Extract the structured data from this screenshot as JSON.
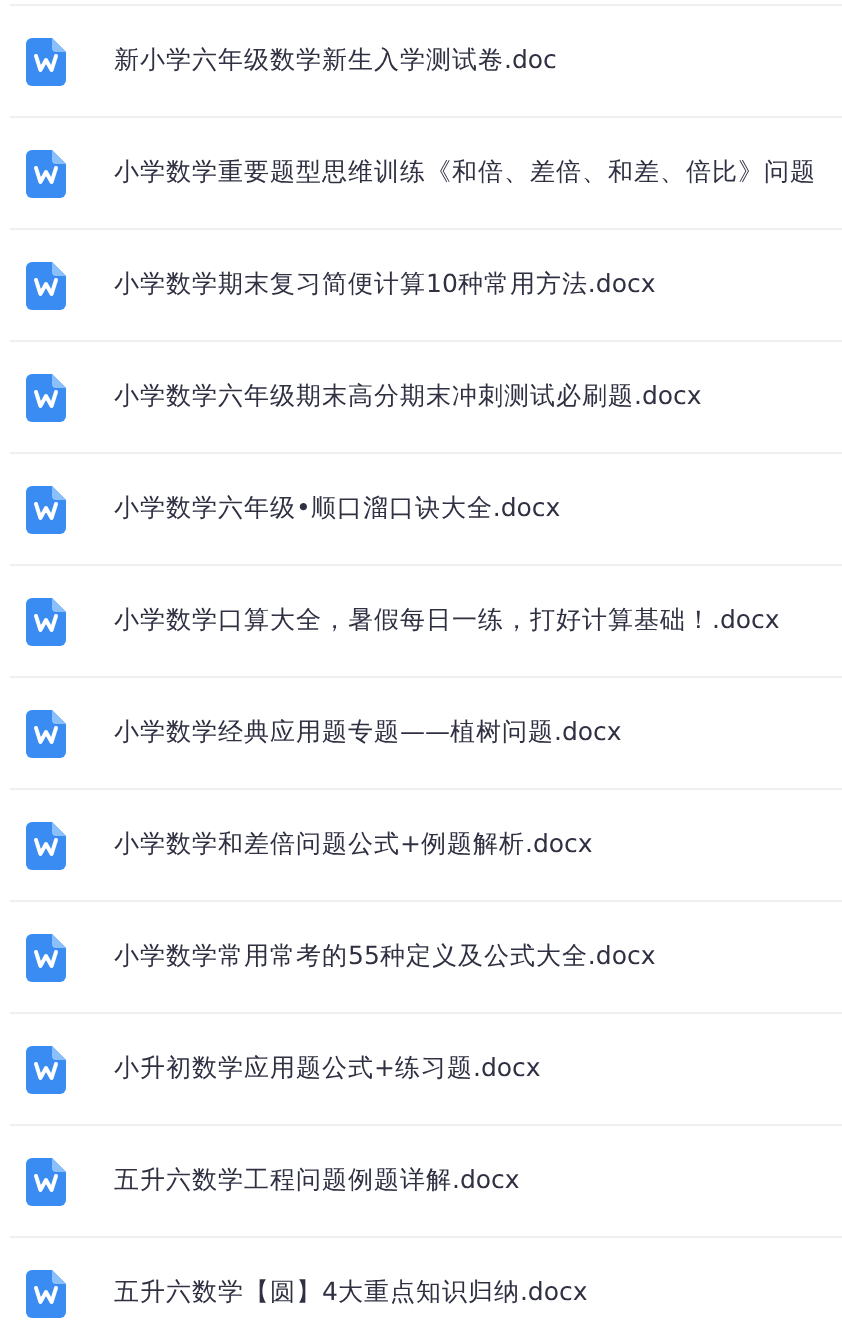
{
  "files": [
    {
      "name": "新小学六年级数学新生入学测试卷.doc"
    },
    {
      "name": "小学数学重要题型思维训练《和倍、差倍、和差、倍比》问题"
    },
    {
      "name": "小学数学期末复习简便计算10种常用方法.docx"
    },
    {
      "name": "小学数学六年级期末高分期末冲刺测试必刷题.docx"
    },
    {
      "name": "小学数学六年级•顺口溜口诀大全.docx"
    },
    {
      "name": "小学数学口算大全，暑假每日一练，打好计算基础！.docx"
    },
    {
      "name": "小学数学经典应用题专题——植树问题.docx"
    },
    {
      "name": "小学数学和差倍问题公式+例题解析.docx"
    },
    {
      "name": "小学数学常用常考的55种定义及公式大全.docx"
    },
    {
      "name": "小升初数学应用题公式+练习题.docx"
    },
    {
      "name": "五升六数学工程问题例题详解.docx"
    },
    {
      "name": "五升六数学【圆】4大重点知识归纳.docx"
    }
  ]
}
